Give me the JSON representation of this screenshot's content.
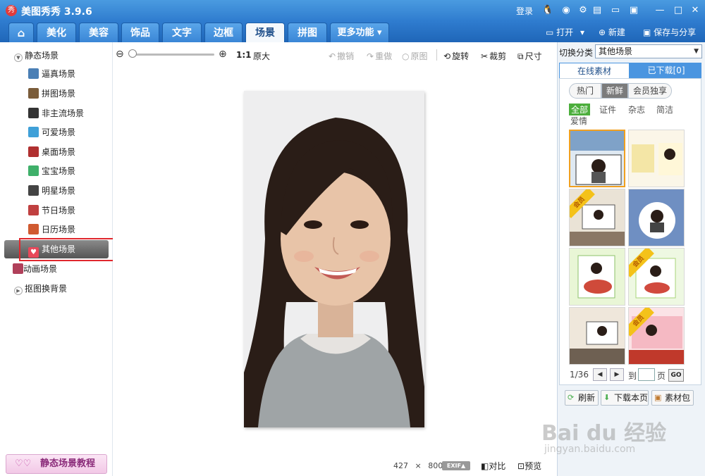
{
  "window": {
    "app_logo": "秀",
    "title": "美图秀秀 3.9.6",
    "login": "登录",
    "icons": [
      "qq-icon",
      "weibo-icon",
      "settings-icon",
      "skin-icon",
      "message-icon",
      "menu-icon"
    ],
    "controls": {
      "minimize": "—",
      "maximize": "□",
      "close": "✕"
    }
  },
  "tabs": [
    {
      "label": "⌂",
      "name": "home"
    },
    {
      "label": "美化",
      "name": "beautify"
    },
    {
      "label": "美容",
      "name": "makeup"
    },
    {
      "label": "饰品",
      "name": "accessories"
    },
    {
      "label": "文字",
      "name": "text"
    },
    {
      "label": "边框",
      "name": "border"
    },
    {
      "label": "场景",
      "name": "scene",
      "active": true
    },
    {
      "label": "拼图",
      "name": "collage"
    },
    {
      "label": "更多功能 ▾",
      "name": "more"
    }
  ],
  "header_actions": {
    "open": "打开",
    "open_arrow": "▾",
    "new": "新建",
    "save_share": "保存与分享"
  },
  "sidebar": {
    "static_group": "静态场景",
    "items": [
      {
        "label": "逼真场景",
        "icon_color": "#4a7fb5"
      },
      {
        "label": "拼图场景",
        "icon_color": "#7a5c3a"
      },
      {
        "label": "非主流场景",
        "icon_color": "#333333"
      },
      {
        "label": "可爱场景",
        "icon_color": "#3fa0d8"
      },
      {
        "label": "桌面场景",
        "icon_color": "#b03030"
      },
      {
        "label": "宝宝场景",
        "icon_color": "#3fb06a"
      },
      {
        "label": "明星场景",
        "icon_color": "#444444"
      },
      {
        "label": "节日场景",
        "icon_color": "#c04040"
      },
      {
        "label": "日历场景",
        "icon_color": "#d05a30"
      },
      {
        "label": "其他场景",
        "icon_color": "#e8485a",
        "selected": true
      }
    ],
    "anim_group": "动画场景",
    "cutout_group": "抠图换背景",
    "tutorial_button": "静态场景教程"
  },
  "toolbar": {
    "zoom_ratio": "1:1",
    "original_size": "原大",
    "undo": "撤销",
    "redo": "重做",
    "original": "原图",
    "rotate": "旋转",
    "crop": "裁剪",
    "resize": "尺寸"
  },
  "canvas": {
    "image_width": "427",
    "times": "×",
    "image_height": "800",
    "exif": "EXIF▲",
    "compare": "对比",
    "preview": "预览"
  },
  "right_panel": {
    "switch_label": "切换分类",
    "category_value": "其他场景",
    "tab_online": "在线素材",
    "tab_downloaded": "已下载[0]",
    "segments": [
      "热门",
      "新鲜",
      "会员独享"
    ],
    "active_segment": "新鲜",
    "filters": [
      "全部",
      "证件",
      "杂志",
      "简洁",
      "爱情"
    ],
    "active_filter": "全部",
    "vip_badge": "会员",
    "pager": {
      "page": "1/36",
      "prev": "◀",
      "next": "▶",
      "to": "到",
      "page_suffix": "页",
      "go": "GO"
    },
    "refresh": "刷新",
    "download_page": "下载本页",
    "material_pack": "素材包"
  },
  "watermark": {
    "brand": "Bai du 经验",
    "url": "jingyan.baidu.com"
  }
}
